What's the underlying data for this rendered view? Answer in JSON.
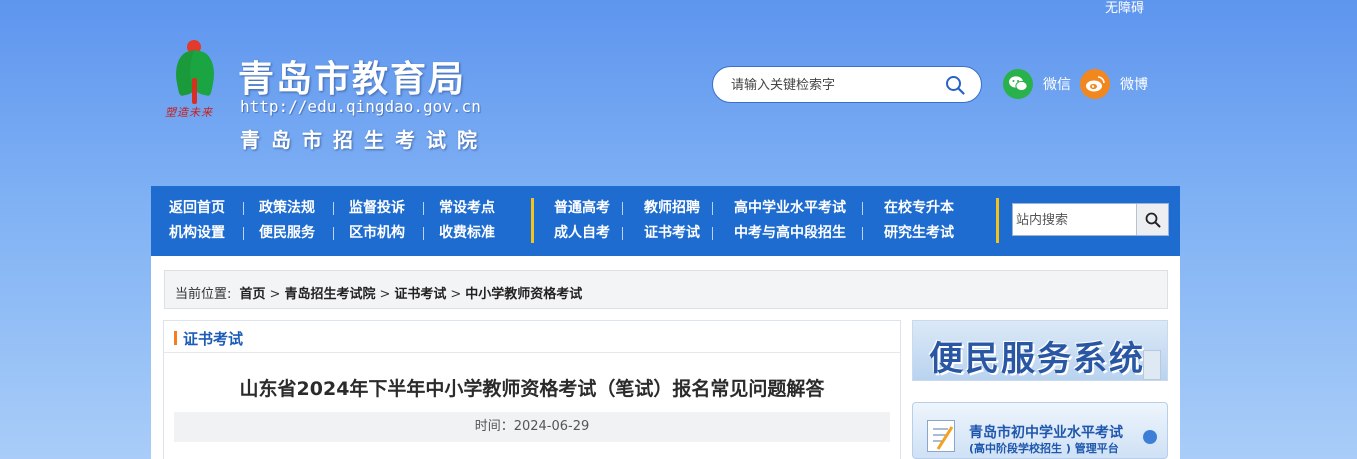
{
  "header": {
    "accessibility_link": "无障碍",
    "logo_motto": "塑造未来",
    "title": "青岛市教育局",
    "url": "http://edu.qingdao.gov.cn",
    "subtitle": "青岛市招生考试院",
    "search_placeholder": "请输入关键检索字",
    "social": [
      {
        "label": "微信",
        "icon": "wechat-icon",
        "color": "#29b24b"
      },
      {
        "label": "微博",
        "icon": "weibo-icon",
        "color": "#f2871e"
      }
    ]
  },
  "nav": {
    "left": [
      [
        "返回首页",
        "政策法规",
        "监督投诉",
        "常设考点"
      ],
      [
        "机构设置",
        "便民服务",
        "区市机构",
        "收费标准"
      ]
    ],
    "right": [
      [
        "普通高考",
        "教师招聘",
        "高中学业水平考试",
        "在校专升本"
      ],
      [
        "成人自考",
        "证书考试",
        "中考与高中段招生",
        "研究生考试"
      ]
    ],
    "search_placeholder": "站内搜索",
    "divider_color": "#f2c31a"
  },
  "breadcrumb": {
    "label": "当前位置:",
    "items": [
      "首页",
      ">",
      "青岛招生考试院",
      ">",
      "证书考试",
      ">",
      "中小学教师资格考试"
    ]
  },
  "article": {
    "section": "证书考试",
    "title": "山东省2024年下半年中小学教师资格考试（笔试）报名常见问题解答",
    "meta": "时间：2024-06-29"
  },
  "sidebar": {
    "banner1": "便民服务系统",
    "banner2_line1": "青岛市初中学业水平考试",
    "banner2_line2": "(高中阶段学校招生 ) 管理平台"
  }
}
